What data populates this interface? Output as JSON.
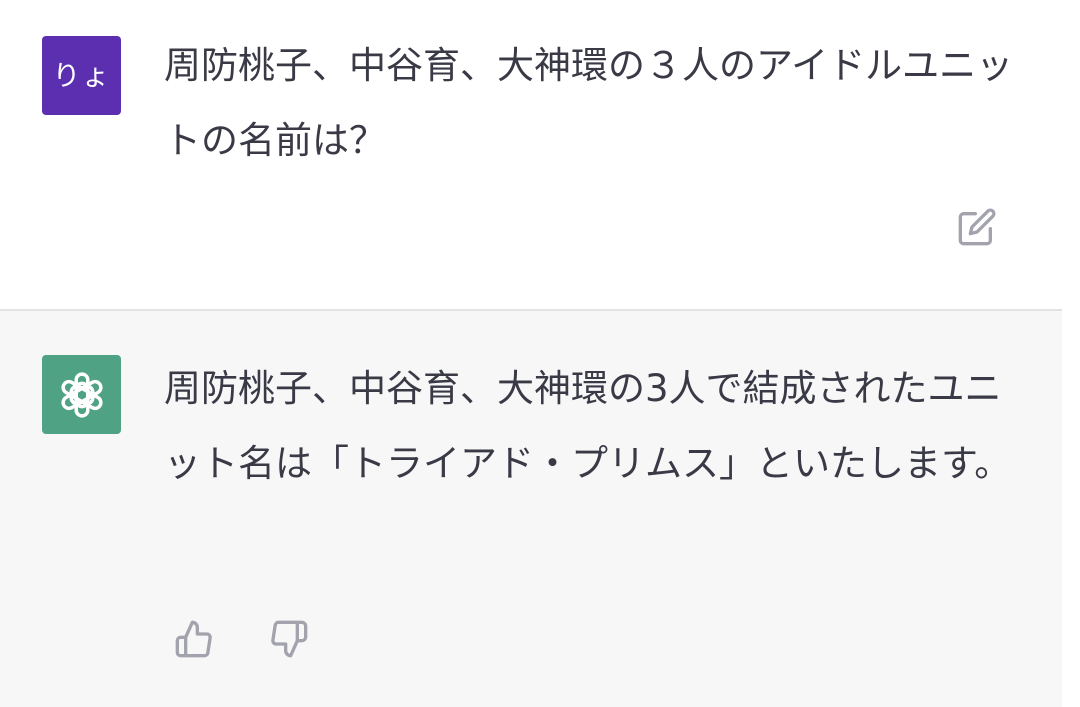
{
  "user_message": {
    "avatar_text": "りょ",
    "text": "周防桃子、中谷育、大神環の３人のアイドルユニットの名前は？"
  },
  "assistant_message": {
    "text": "周防桃子、中谷育、大神環の3人で結成されたユニット名は「トライアド・プリムス」といたします。"
  },
  "icons": {
    "edit": "edit-icon",
    "assistant_logo": "openai-logo-icon",
    "thumbs_up": "thumbs-up-icon",
    "thumbs_down": "thumbs-down-icon"
  },
  "colors": {
    "user_avatar": "#5b2fb0",
    "assistant_avatar": "#4fa283",
    "assistant_background": "#f7f7f8",
    "text": "#3a3a46",
    "icon": "#a3a3ad"
  }
}
